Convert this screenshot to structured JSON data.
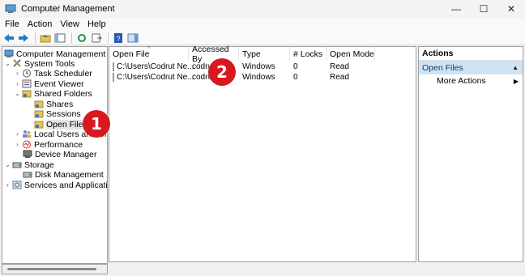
{
  "window": {
    "title": "Computer Management",
    "minimize": "—",
    "maximize": "☐",
    "close": "✕"
  },
  "menu": [
    "File",
    "Action",
    "View",
    "Help"
  ],
  "tree": {
    "root": "Computer Management (Local)",
    "system_tools": "System Tools",
    "task_scheduler": "Task Scheduler",
    "event_viewer": "Event Viewer",
    "shared_folders": "Shared Folders",
    "shares": "Shares",
    "sessions": "Sessions",
    "open_files": "Open Files",
    "local_users": "Local Users and Groups",
    "performance": "Performance",
    "device_manager": "Device Manager",
    "storage": "Storage",
    "disk_management": "Disk Management",
    "services_apps": "Services and Applications"
  },
  "list": {
    "columns": [
      "Open File",
      "Accessed By",
      "Type",
      "# Locks",
      "Open Mode"
    ],
    "rows": [
      {
        "file": "C:\\Users\\Codrut Ne...",
        "accessed_by": "codrut",
        "type": "Windows",
        "locks": "0",
        "mode": "Read"
      },
      {
        "file": "C:\\Users\\Codrut Ne...",
        "accessed_by": "codrut",
        "type": "Windows",
        "locks": "0",
        "mode": "Read"
      }
    ]
  },
  "actions": {
    "header": "Actions",
    "section": "Open Files",
    "more": "More Actions"
  },
  "badges": [
    "1",
    "2"
  ],
  "colors": {
    "badge": "#d7181f",
    "selection": "#cfe3f3"
  }
}
